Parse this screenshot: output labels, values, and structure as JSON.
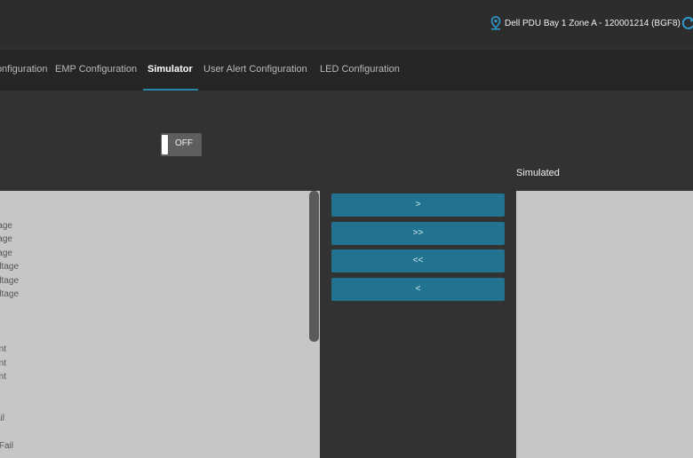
{
  "device": {
    "label": "Dell PDU Bay 1 Zone A - 120001214 (BGF8)"
  },
  "tabs": [
    {
      "label": "Configuration",
      "active": false
    },
    {
      "label": "EMP Configuration",
      "active": false
    },
    {
      "label": "Simulator",
      "active": true
    },
    {
      "label": "User Alert Configuration",
      "active": false
    },
    {
      "label": "LED Configuration",
      "active": false
    }
  ],
  "simulator": {
    "toggle_label": "OFF",
    "simulated_header": "Simulated",
    "available_items": [
      "Voltage",
      "Voltage",
      "Voltage",
      "Over Voltage",
      "Over Voltage",
      "Over Voltage",
      "Current",
      "Current",
      "Current",
      "Fail",
      "Fail"
    ],
    "buttons": {
      "add": ">",
      "add_all": ">>",
      "remove_all": "<<",
      "remove": "<"
    }
  },
  "colors": {
    "accent": "#2a86a8",
    "button": "#217390",
    "panel": "#c6c6c6"
  }
}
